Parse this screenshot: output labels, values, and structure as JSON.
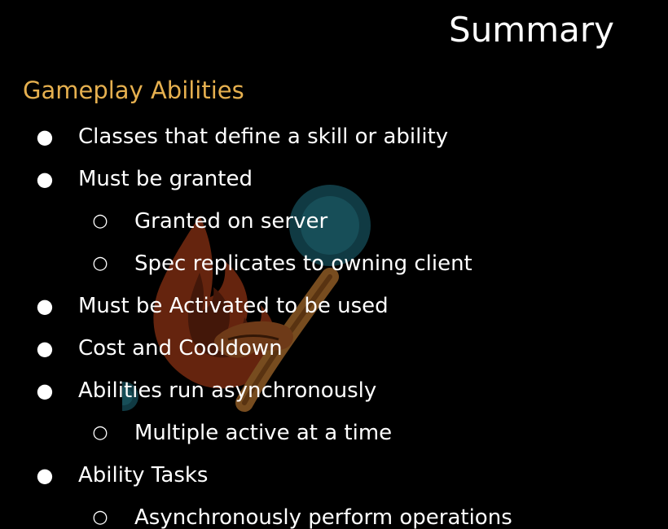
{
  "slide": {
    "title": "Summary",
    "section_heading": "Gameplay Abilities",
    "accent_color": "#e6b04f",
    "watermark_icon": "flaming-torch-icon",
    "bullets": [
      {
        "level": 1,
        "marker": "●",
        "text": "Classes that define a skill or ability"
      },
      {
        "level": 1,
        "marker": "●",
        "text": "Must be granted"
      },
      {
        "level": 2,
        "marker": "○",
        "text": "Granted on server"
      },
      {
        "level": 2,
        "marker": "○",
        "text": "Spec replicates to owning client"
      },
      {
        "level": 1,
        "marker": "●",
        "text": "Must be Activated to be used"
      },
      {
        "level": 1,
        "marker": "●",
        "text": "Cost and Cooldown"
      },
      {
        "level": 1,
        "marker": "●",
        "text": "Abilities run asynchronously"
      },
      {
        "level": 2,
        "marker": "○",
        "text": "Multiple active at a time"
      },
      {
        "level": 1,
        "marker": "●",
        "text": "Ability Tasks"
      },
      {
        "level": 2,
        "marker": "○",
        "text": "Asynchronously perform operations"
      }
    ]
  }
}
